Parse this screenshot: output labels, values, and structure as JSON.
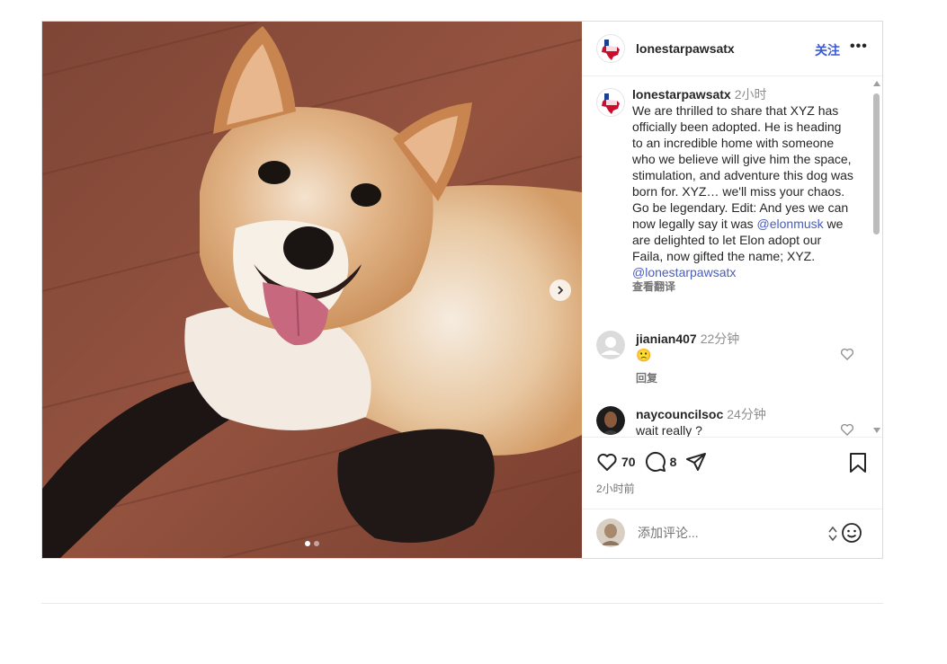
{
  "post": {
    "account": "lonestarpawsatx",
    "follow_label": "关注",
    "more_label": "•••",
    "caption": {
      "username": "lonestarpawsatx",
      "time": "2小时",
      "text_part1": "We are thrilled to share that XYZ has officially been adopted. He is heading to an incredible home with someone who we believe will give him the space, stimulation, and adventure this dog was born for. XYZ… we'll miss your chaos. Go be legendary. Edit: And yes we can now legally say it was ",
      "mention1": "@elonmusk",
      "text_part2": " we are delighted to let Elon adopt our Faila, now gifted the name; XYZ.",
      "mention2": "@lonestarpawsatx",
      "translate_label": "查看翻译"
    },
    "comments": [
      {
        "username": "jianian407",
        "time": "22分钟",
        "text": "🙁",
        "reply_label": "回复"
      },
      {
        "username": "naycouncilsoc",
        "time": "24分钟",
        "text": "wait really ?"
      }
    ],
    "likes": "70",
    "comment_count": "8",
    "post_time": "2小时前",
    "add_comment_placeholder": "添加评论...",
    "carousel": {
      "current": 1,
      "total": 2
    }
  },
  "colors": {
    "link": "#3a59d6",
    "mention": "#4a5dbb",
    "muted": "#737373"
  },
  "icons": [
    "next-arrow-icon",
    "more-icon",
    "heart-icon",
    "comment-icon",
    "share-icon",
    "bookmark-icon",
    "emoji-icon",
    "resize-icon"
  ]
}
